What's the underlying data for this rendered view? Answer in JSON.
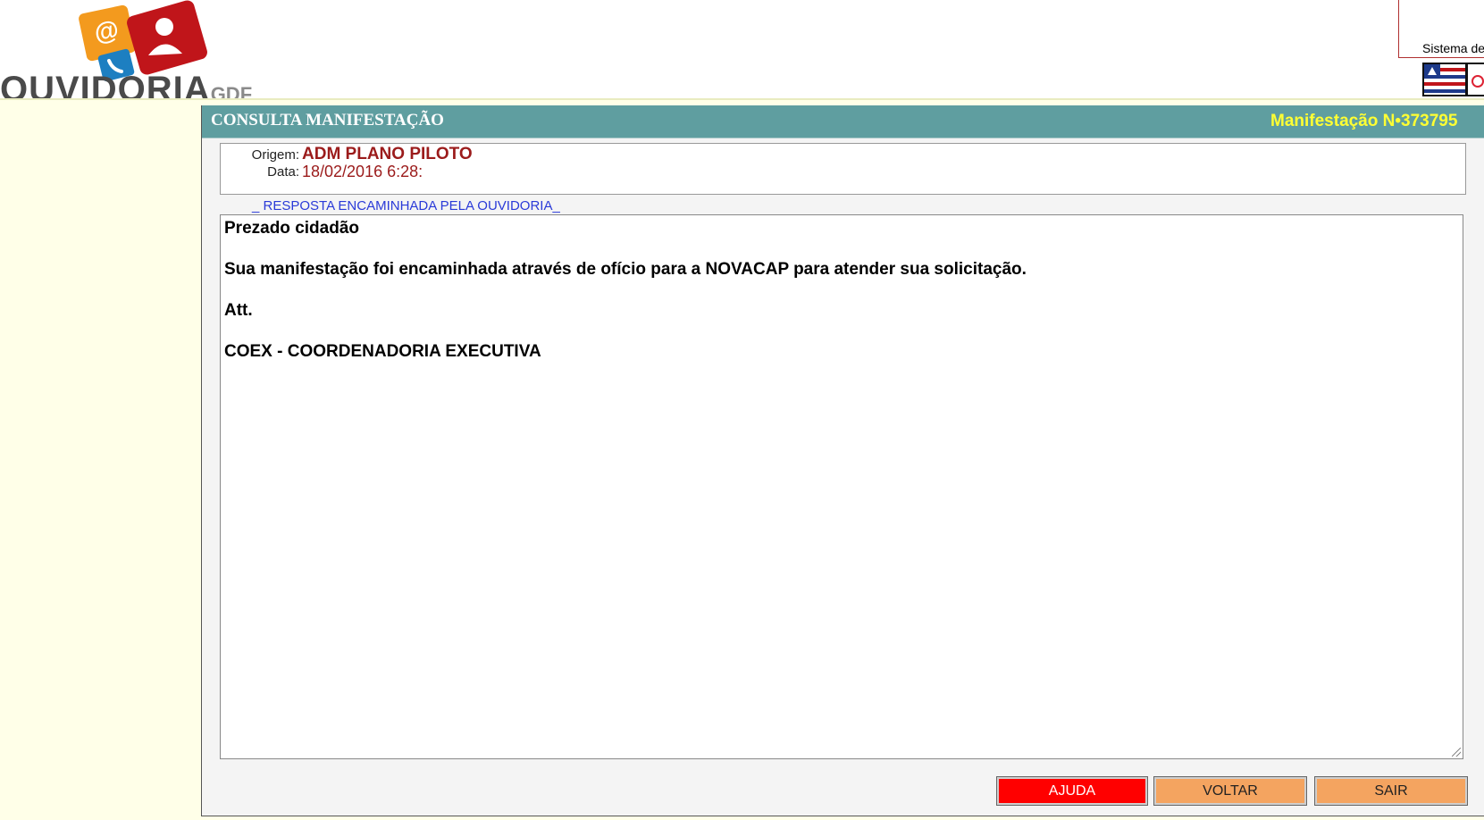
{
  "header": {
    "logo_text": "OUVIDORIA",
    "logo_suffix": "GDF",
    "system_text": "Sistema de"
  },
  "panel": {
    "title": "CONSULTA MANIFESTAÇÃO",
    "manifestation_number": "Manifestação N•373795"
  },
  "info": {
    "origem_label": "Origem:",
    "origem_value": "ADM PLANO PILOTO",
    "data_label": "Data:",
    "data_value": "18/02/2016 6:28:"
  },
  "response": {
    "link_text": "_ RESPOSTA ENCAMINHADA PELA OUVIDORIA_",
    "lines": [
      "Prezado cidadão",
      "Sua manifestação foi encaminhada através de ofício para a NOVACAP para atender sua solicitação.",
      "Att.",
      "COEX - COORDENADORIA EXECUTIVA"
    ]
  },
  "buttons": {
    "help": "AJUDA",
    "back": "VOLTAR",
    "exit": "SAIR"
  },
  "colors": {
    "header_bar": "#5f9ea0",
    "number_text": "#ffff33",
    "value_text": "#9b1b1b",
    "link_text": "#2a3ad8",
    "help_button": "#ff0000",
    "nav_button": "#f4a460",
    "page_background": "#ffffe8"
  }
}
